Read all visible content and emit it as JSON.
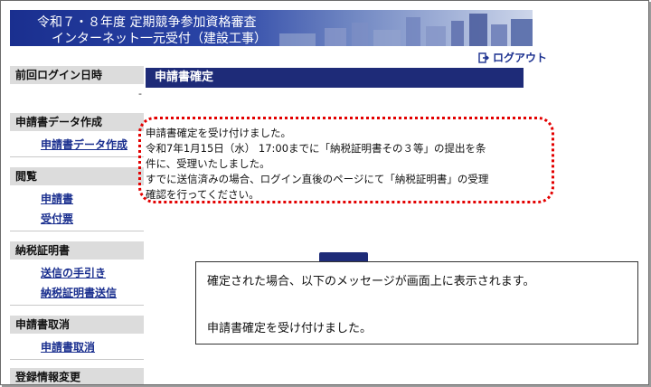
{
  "header": {
    "title_line1": "令和７・８年度 定期競争参加資格審査",
    "title_line2": "インターネット一元受付（建設工事）",
    "logout_label": "ログアウト",
    "logout_icon": "logout-icon"
  },
  "sidebar": {
    "last_login_heading": "前回ログイン日時",
    "last_login_value": "-",
    "sections": [
      {
        "heading": "申請書データ作成",
        "links": [
          "申請書データ作成"
        ]
      },
      {
        "heading": "閲覧",
        "links": [
          "申請書",
          "受付票"
        ]
      },
      {
        "heading": "納税証明書",
        "links": [
          "送信の手引き",
          "納税証明書送信"
        ]
      },
      {
        "heading": "申請書取消",
        "links": [
          "申請書取消"
        ]
      },
      {
        "heading": "登録情報変更",
        "links": []
      }
    ]
  },
  "main": {
    "title": "申請書確定",
    "message_lines": [
      "申請書確定を受け付けました。",
      "令和7年1月15日（水） 17:00までに「納税証明書その３等」の提出を条",
      "件に、受理いたしました。",
      "すでに送信済みの場合、ログイン直後のページにて「納税証明書」の受理",
      "確認を行ってください。"
    ],
    "highlight_color": "#e30000"
  },
  "callout": {
    "line1": "確定された場合、以下のメッセージが画面上に表示されます。",
    "line2": "申請書確定を受け付けました。"
  },
  "colors": {
    "banner": "#1a2f8f",
    "title_bar": "#1e2b78",
    "link": "#1a2f8f",
    "sidebar_heading_bg": "#dcdcdc"
  }
}
